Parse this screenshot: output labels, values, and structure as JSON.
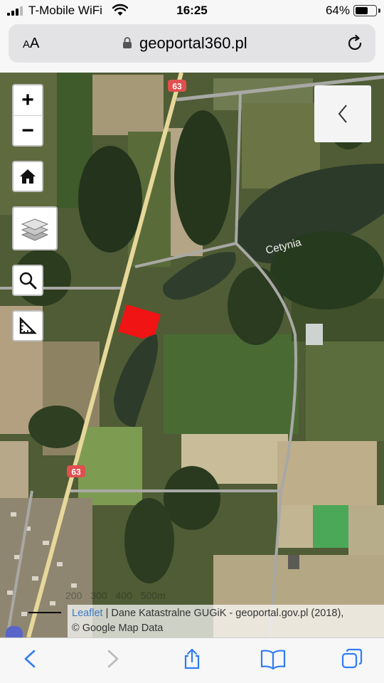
{
  "status_bar": {
    "carrier": "T-Mobile WiFi",
    "time": "16:25",
    "battery_percent": "64%",
    "battery_level": 0.64,
    "icons": [
      "signal-icon",
      "wifi-icon",
      "battery-icon"
    ]
  },
  "address_bar": {
    "text_size_small": "A",
    "text_size_large": "A",
    "url": "geoportal360.pl",
    "icons": [
      "lock-icon",
      "reload-icon"
    ]
  },
  "map": {
    "road_shield_top": "63",
    "road_shield_bottom": "63",
    "lake_label": "Cetynia",
    "controls": {
      "zoom_in": "+",
      "zoom_out": "−",
      "icons": [
        "home-icon",
        "layers-icon",
        "search-icon",
        "measure-icon",
        "chevron-left-icon"
      ]
    },
    "scale_labels": "200 300 400 500m",
    "attribution": {
      "link": "Leaflet",
      "text": " | Dane Katastralne GUGiK - geoportal.gov.pl (2018),",
      "text2": "© Google Map Data"
    },
    "colors": {
      "parcel_highlight": "#f01414",
      "road": "#e6d89a",
      "field_dark": "#4b5a32",
      "water": "#2f3d2c"
    }
  },
  "toolbar": {
    "icons": [
      "back-icon",
      "forward-icon",
      "share-icon",
      "bookmarks-icon",
      "tabs-icon"
    ],
    "accent": "#2f7cf6"
  }
}
